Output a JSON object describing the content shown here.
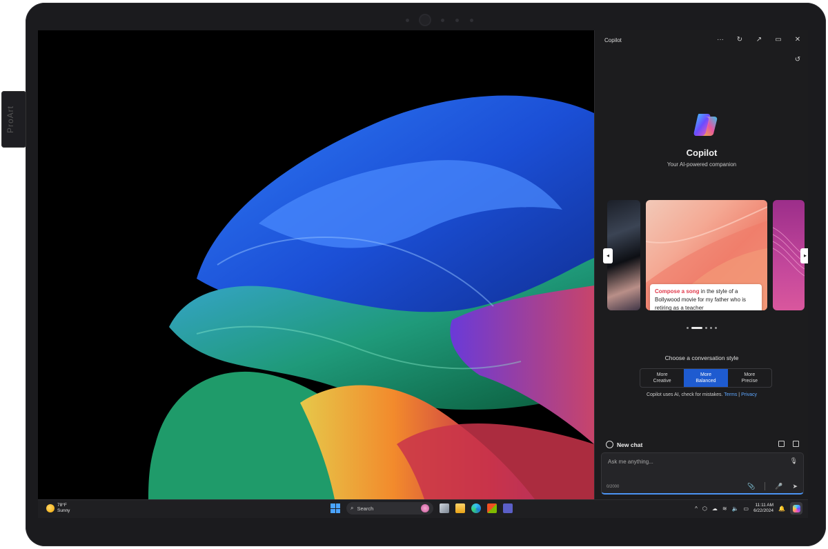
{
  "device": {
    "pen_label": "ProArt"
  },
  "copilot": {
    "window_title": "Copilot",
    "controls": {
      "more": "···",
      "refresh": "↻",
      "open": "↗",
      "dock": "▭",
      "close": "✕"
    },
    "history_icon": "↺",
    "name": "Copilot",
    "tagline": "Your AI-powered companion",
    "carousel": {
      "prompt_highlight": "Compose a song",
      "prompt_rest": " in the style of a Bollywood movie for my father who is retiring as a teacher",
      "prev_label": "◂",
      "next_label": "▸",
      "dots": 5,
      "active_dot": 1
    },
    "style": {
      "label": "Choose a conversation style",
      "options": [
        {
          "line1": "More",
          "line2": "Creative"
        },
        {
          "line1": "More",
          "line2": "Balanced"
        },
        {
          "line1": "More",
          "line2": "Precise"
        }
      ],
      "selected": "Balanced"
    },
    "disclaimer": {
      "text": "Copilot uses AI, check for mistakes. ",
      "terms": "Terms",
      "sep": " | ",
      "privacy": "Privacy"
    },
    "new_chat": "New chat",
    "input": {
      "placeholder": "Ask me anything...",
      "counter": "0/2000"
    }
  },
  "taskbar": {
    "weather": {
      "temp": "78°F",
      "condition": "Sunny"
    },
    "search_placeholder": "Search",
    "apps": [
      "task-view",
      "file-explorer",
      "edge",
      "store",
      "teams"
    ],
    "tray_chevron": "^",
    "time": "11:11 AM",
    "date": "6/22/2024"
  },
  "colors": {
    "accent": "#1e5bd0",
    "link": "#5ea7ff",
    "panel": "#1c1c1e"
  }
}
